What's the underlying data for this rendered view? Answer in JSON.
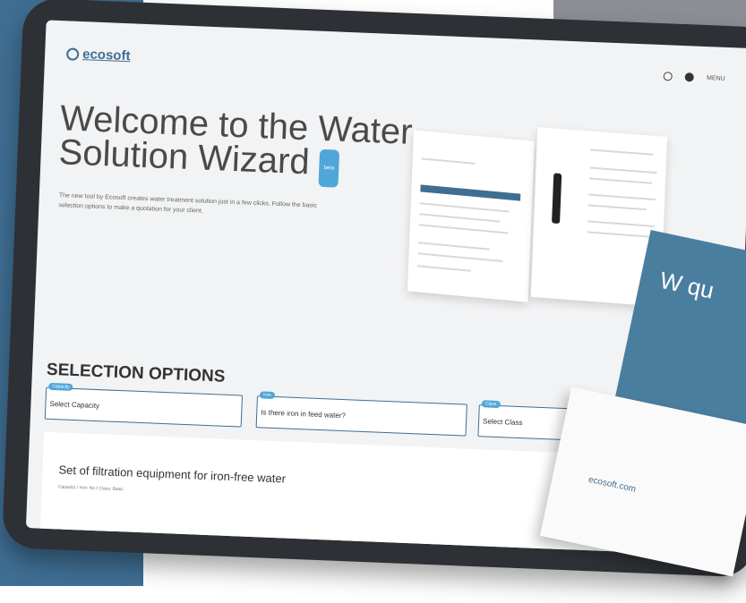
{
  "header": {
    "logo": "ecosoft",
    "menu_label": "MENU"
  },
  "hero": {
    "title": "Welcome to the Water Solution Wizard",
    "badge": "beta",
    "description": "The new tool by Ecosoft creates water treatment solution just in a few clicks. Follow the basic selection options to make a quotation for your client."
  },
  "selection": {
    "title": "SELECTION OPTIONS",
    "options": [
      {
        "tag": "Capacity",
        "placeholder": "Select Capacity"
      },
      {
        "tag": "Iron",
        "placeholder": "Is there iron in feed water?"
      },
      {
        "tag": "Class",
        "placeholder": "Select Class"
      }
    ]
  },
  "result": {
    "title": "Set of filtration equipment for iron-free water",
    "meta": "Capacity / Iron: No / Class: Basic"
  },
  "brochure_back": {
    "site": "ecosoft.com",
    "heading": "W qu"
  },
  "colors": {
    "brand_blue": "#3f6e93",
    "accent": "#4fa7d9"
  }
}
